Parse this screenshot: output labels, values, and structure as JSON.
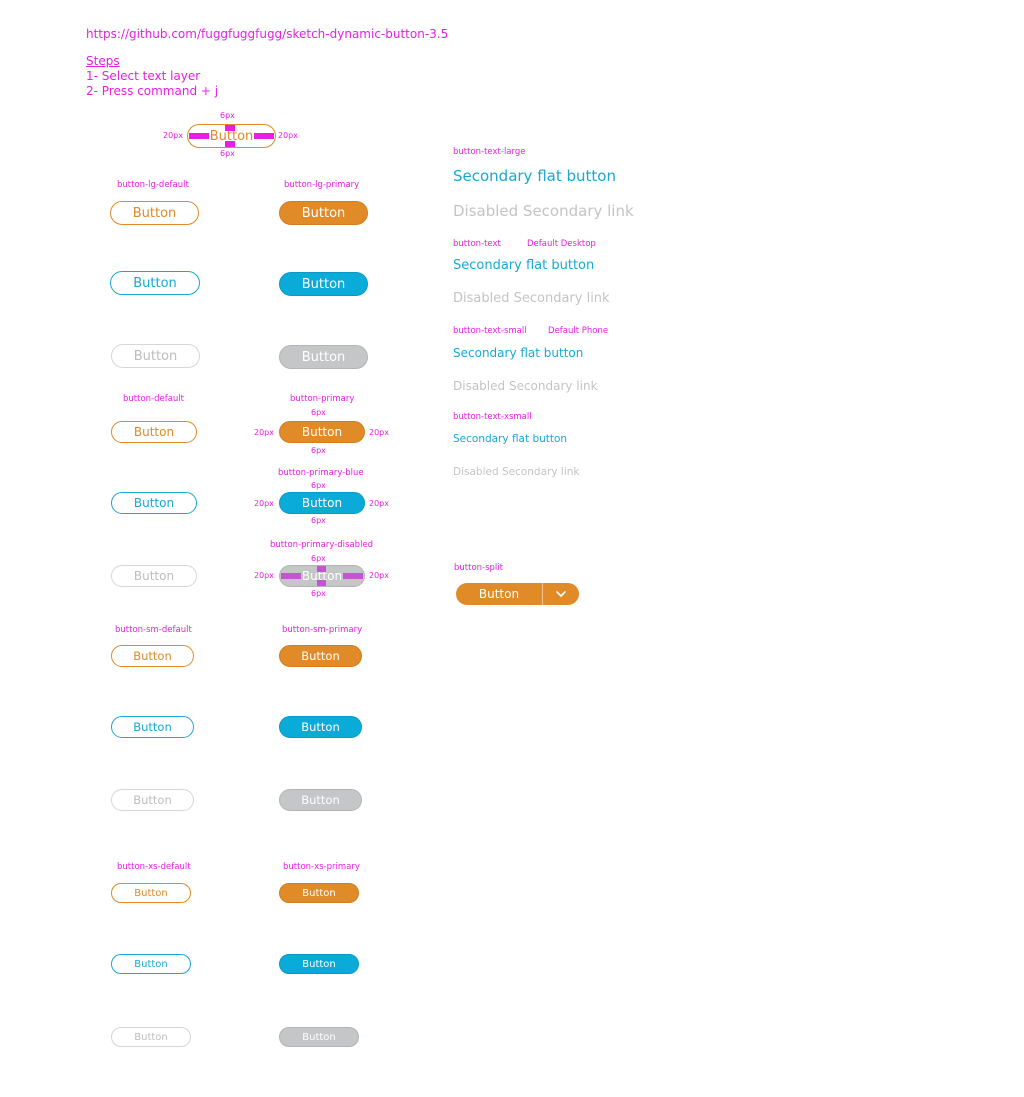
{
  "header": {
    "repo_link": "https://github.com/fuggfuggfugg/sketch-dynamic-button-3.5",
    "steps_title": "Steps",
    "step_1": "1- Select text layer",
    "step_2": "2- Press command + j"
  },
  "common": {
    "button_label": "Button"
  },
  "dims": {
    "vertical": "6px",
    "horizontal": "20px"
  },
  "sections": {
    "lg_default": "button-lg-default",
    "lg_primary": "button-lg-primary",
    "default": "button-default",
    "primary": "button-primary",
    "primary_blue": "button-primary-blue",
    "primary_disabled": "button-primary-disabled",
    "sm_default": "button-sm-default",
    "sm_primary": "button-sm-primary",
    "xs_default": "button-xs-default",
    "xs_primary": "button-xs-primary",
    "split": "button-split"
  },
  "text_buttons": {
    "large": {
      "label": "button-text-large",
      "link": "Secondary flat button",
      "disabled": "Disabled Secondary link"
    },
    "normal": {
      "label": "button-text",
      "note": "Default Desktop",
      "link": "Secondary flat button",
      "disabled": "Disabled Secondary link"
    },
    "small": {
      "label": "button-text-small",
      "note": "Default Phone",
      "link": "Secondary flat button",
      "disabled": "Disabled Secondary link"
    },
    "xsmall": {
      "label": "button-text-xsmall",
      "link": "Secondary flat button",
      "disabled": "Disabled Secondary link"
    }
  },
  "colors": {
    "annotation": "#e81fe2",
    "orange": "#e08a28",
    "blue": "#0aaad9",
    "disabled_gray": "#c4c6c8",
    "disabled_text": "#c4c4c4"
  },
  "icons": {
    "split_caret": "chevron-down-icon"
  }
}
